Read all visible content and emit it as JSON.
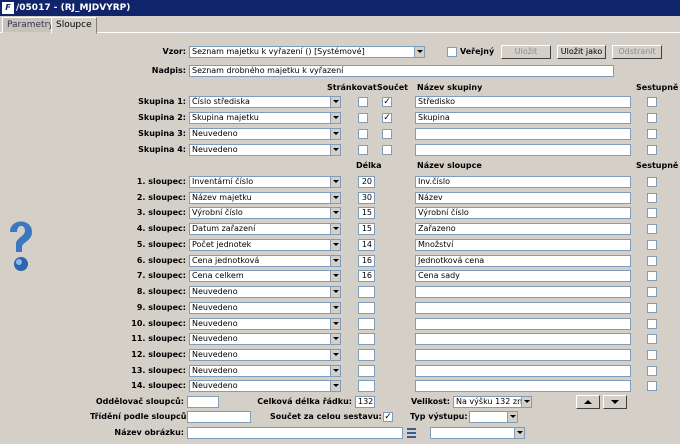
{
  "window": {
    "title": "/05017 - (RJ_MJDVYRP)",
    "app_icon": "F"
  },
  "tabs": [
    {
      "label": "Parametry"
    },
    {
      "label": "Sloupce"
    }
  ],
  "vzor": {
    "label": "Vzor:",
    "value": "Seznam majetku k vyřazení  ()  [Systémové]"
  },
  "verejny": {
    "label": "Veřejný",
    "checked": false
  },
  "buttons": {
    "ulozit": "Uložit",
    "ulozit_jako": "Uložit jako",
    "odstranit": "Odstranit"
  },
  "nadpis": {
    "label": "Nadpis:",
    "value": "Seznam drobného majetku k vyřazení"
  },
  "group_headers": {
    "strankovat": "Stránkovat",
    "soucet": "Součet",
    "nazev_skupiny": "Název skupiny",
    "sestupne": "Sestupně"
  },
  "groups": [
    {
      "label": "Skupina 1:",
      "value": "Číslo střediska",
      "strankovat": false,
      "soucet": true,
      "name": "Středisko",
      "desc": false
    },
    {
      "label": "Skupina 2:",
      "value": "Skupina majetku",
      "strankovat": false,
      "soucet": true,
      "name": "Skupina",
      "desc": false
    },
    {
      "label": "Skupina 3:",
      "value": "Neuvedeno",
      "strankovat": false,
      "soucet": false,
      "name": "",
      "desc": false
    },
    {
      "label": "Skupina 4:",
      "value": "Neuvedeno",
      "strankovat": false,
      "soucet": false,
      "name": "",
      "desc": false
    }
  ],
  "column_headers": {
    "delka": "Délka",
    "nazev_sloupce": "Název sloupce",
    "sestupne": "Sestupně"
  },
  "columns": [
    {
      "label": "1. sloupec:",
      "value": "Inventární číslo",
      "length": "20",
      "name": "Inv.číslo",
      "desc": false
    },
    {
      "label": "2. sloupec:",
      "value": "Název majetku",
      "length": "30",
      "name": "Název",
      "desc": false
    },
    {
      "label": "3. sloupec:",
      "value": "Výrobní číslo",
      "length": "15",
      "name": "Výrobní číslo",
      "desc": false
    },
    {
      "label": "4. sloupec:",
      "value": "Datum zařazení",
      "length": "15",
      "name": "Zařazeno",
      "desc": false
    },
    {
      "label": "5. sloupec:",
      "value": "Počet jednotek",
      "length": "14",
      "name": "Množství",
      "desc": false
    },
    {
      "label": "6. sloupec:",
      "value": "Cena jednotková",
      "length": "16",
      "name": "Jednotková cena",
      "desc": false
    },
    {
      "label": "7. sloupec:",
      "value": "Cena celkem",
      "length": "16",
      "name": "Cena sady",
      "desc": false
    },
    {
      "label": "8. sloupec:",
      "value": "Neuvedeno",
      "length": "",
      "name": "",
      "desc": false
    },
    {
      "label": "9. sloupec:",
      "value": "Neuvedeno",
      "length": "",
      "name": "",
      "desc": false
    },
    {
      "label": "10. sloupec:",
      "value": "Neuvedeno",
      "length": "",
      "name": "",
      "desc": false
    },
    {
      "label": "11. sloupec:",
      "value": "Neuvedeno",
      "length": "",
      "name": "",
      "desc": false
    },
    {
      "label": "12. sloupec:",
      "value": "Neuvedeno",
      "length": "",
      "name": "",
      "desc": false
    },
    {
      "label": "13. sloupec:",
      "value": "Neuvedeno",
      "length": "",
      "name": "",
      "desc": false
    },
    {
      "label": "14. sloupec:",
      "value": "Neuvedeno",
      "length": "",
      "name": "",
      "desc": false
    }
  ],
  "bottom": {
    "oddelovac_label": "Oddělovač sloupců:",
    "oddelovac_value": "",
    "celkova_label": "Celková délka řádku:",
    "celkova_value": "132",
    "velikost_label": "Velikost:",
    "velikost_value": "Na výšku 132 zn.",
    "trideni_label": "Třídění podle sloupců:",
    "trideni_value": "",
    "soucet_label": "Součet za celou sestavu:",
    "soucet_checked": true,
    "typ_label": "Typ výstupu:",
    "typ_value": "",
    "obrazek_label": "Název obrázku:",
    "obrazek_value": "",
    "obrazek_select_value": ""
  },
  "colors": {
    "titlebar": "#10246a",
    "background": "#d4d0c8",
    "help_icon": "#3a78c0"
  }
}
